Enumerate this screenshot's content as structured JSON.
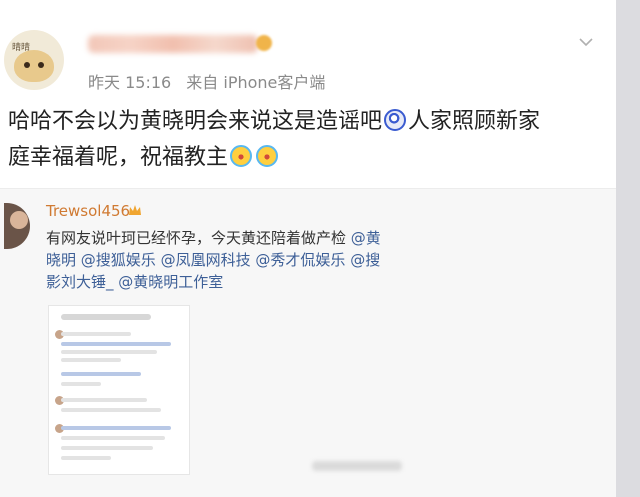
{
  "post": {
    "avatar_tag": "晴晴",
    "meta_time": "昨天 15:16",
    "meta_source": "来自 iPhone客户端",
    "body_line1": "哈哈不会以为黄晓明会来说这是造谣吧",
    "body_line1b": "人家照顾新家",
    "body_line2": "庭幸福着呢，祝福教主"
  },
  "repost": {
    "username": "Trewsol456",
    "text_prefix": "有网友说叶珂已经怀孕，今天黄还陪着做产检 ",
    "mention_1": "@黄",
    "line2_mentions": [
      "晓明",
      "@搜狐娱乐",
      "@凤凰网科技",
      "@秀才侃娱乐",
      "@搜"
    ],
    "line3_mentions": [
      "影刘大锤_",
      "@黄晓明工作室"
    ]
  },
  "colors": {
    "link": "#3d5f97",
    "repost_name": "#d07a32",
    "meta": "#8a8a8a",
    "card_bg": "#ffffff",
    "repost_bg": "#f7f7f7"
  },
  "icons": [
    "chevron-down-icon",
    "crown-icon",
    "laugh-emoji-icon",
    "cry-emoji-icon"
  ]
}
